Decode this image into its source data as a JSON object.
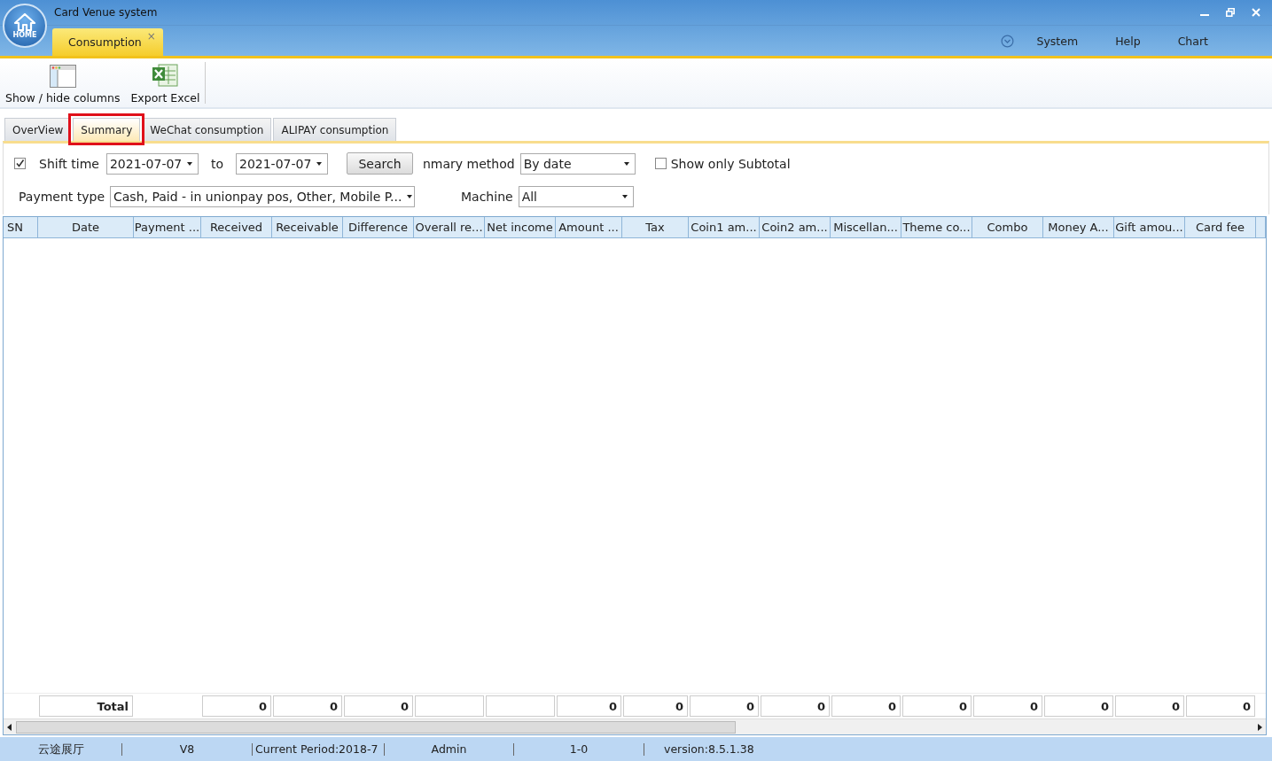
{
  "window": {
    "title": "Card Venue system",
    "logo_text": "HOME"
  },
  "doc_tabs": [
    {
      "label": "Consumption",
      "selected": true,
      "close": "×"
    }
  ],
  "menu": [
    "System",
    "Help",
    "Chart"
  ],
  "toolbar": [
    {
      "label": "Show / hide columns",
      "kind": "columns"
    },
    {
      "label": "Export Excel",
      "kind": "excel"
    }
  ],
  "tabs": [
    {
      "label": "OverView",
      "selected": false
    },
    {
      "label": "Summary",
      "selected": true
    },
    {
      "label": "WeChat consumption",
      "selected": false
    },
    {
      "label": "ALIPAY consumption",
      "selected": false
    }
  ],
  "filters": {
    "shift_checked": true,
    "shift_label": "Shift time",
    "from": "2021-07-07",
    "to_label": "to",
    "to": "2021-07-07",
    "search": "Search",
    "method_label": "nmary method",
    "method": "By date",
    "subtotal_checked": false,
    "subtotal_label": "Show only Subtotal",
    "payment_label": "Payment type",
    "payment": "Cash, Paid - in unionpay pos, Other, Mobile P...",
    "machine_label": "Machine",
    "machine": "All"
  },
  "table": {
    "columns": [
      "SN",
      "Date",
      "Payment ...",
      "Received",
      "Receivable",
      "Difference",
      "Overall re...",
      "Net income",
      "Amount ...",
      "Tax",
      "Coin1 am...",
      "Coin2 am...",
      "Miscellan...",
      "Theme co...",
      "Combo",
      "Money A...",
      "Gift amou...",
      "Card fee"
    ],
    "total_row": [
      {
        "kind": "blank"
      },
      {
        "kind": "label",
        "text": "Total"
      },
      {
        "kind": "blank"
      },
      {
        "kind": "value",
        "text": "0"
      },
      {
        "kind": "value",
        "text": "0"
      },
      {
        "kind": "value",
        "text": "0"
      },
      {
        "kind": "empty"
      },
      {
        "kind": "empty"
      },
      {
        "kind": "value",
        "text": "0"
      },
      {
        "kind": "value",
        "text": "0"
      },
      {
        "kind": "value",
        "text": "0"
      },
      {
        "kind": "value",
        "text": "0"
      },
      {
        "kind": "value",
        "text": "0"
      },
      {
        "kind": "value",
        "text": "0"
      },
      {
        "kind": "value",
        "text": "0"
      },
      {
        "kind": "value",
        "text": "0"
      },
      {
        "kind": "value",
        "text": "0"
      },
      {
        "kind": "value",
        "text": "0"
      }
    ]
  },
  "status_bar": [
    "云途展厅",
    "V8",
    "Current Period:2018-7",
    "Admin",
    "1-0",
    "version:8.5.1.38"
  ]
}
